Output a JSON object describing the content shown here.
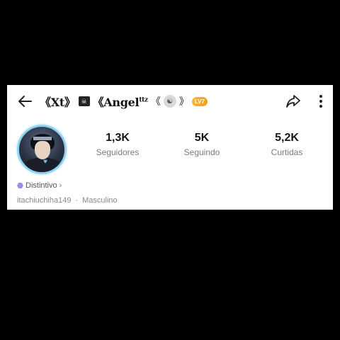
{
  "header": {
    "back_icon": "arrow-left-icon",
    "username": {
      "part1": "《Xt》",
      "tag": "☠",
      "part2": "《Angel",
      "sup": "ttz",
      "deco_left": "《",
      "spirit": "☯",
      "deco_right": "》",
      "level": "LV7"
    },
    "share_icon": "share-icon",
    "more_icon": "more-vertical-icon"
  },
  "stats": [
    {
      "value": "1,3K",
      "label": "Seguidores"
    },
    {
      "value": "5K",
      "label": "Seguindo"
    },
    {
      "value": "5,2K",
      "label": "Curtidas"
    }
  ],
  "badge": {
    "icon": "hexagon-badge-icon",
    "label": "Distintivo",
    "chevron": "›"
  },
  "meta": {
    "handle": "itachiuchiha149",
    "separator": "·",
    "gender": "Masculino"
  },
  "colors": {
    "avatar_ring": "#8fd3f0",
    "badge": "#9b8fe8",
    "level_badge": "#f0a21a"
  }
}
